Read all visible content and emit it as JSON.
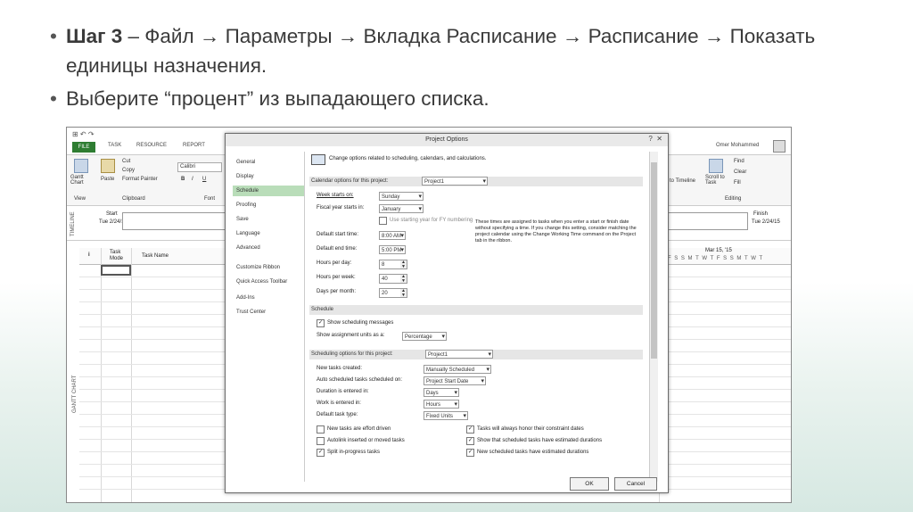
{
  "slide": {
    "bullet1_bold": "Шаг 3",
    "bullet1_text": " – Файл → Параметры → Вкладка Расписание → Расписание → Показать единицы назначения.",
    "bullet2_text": "Выберите “процент” из выпадающего списка."
  },
  "app": {
    "quick_access": "⊞ ↶ ↷",
    "tabs": [
      "FILE",
      "TASK",
      "RESOURCE",
      "REPORT"
    ],
    "user": "Omer Mohammed",
    "ribbon": {
      "gantt_chart": "Gantt Chart",
      "paste": "Paste",
      "cut": "Cut",
      "copy": "Copy",
      "format_painter": "Format Painter",
      "font": "Calibri",
      "bold": "B",
      "italic": "I",
      "underline": "U",
      "group_view": "View",
      "group_clipboard": "Clipboard",
      "group_font": "Font",
      "find": "Find",
      "clear": "Clear",
      "fill": "Fill",
      "scroll_to_task": "Scroll to Task",
      "to_timeline": "to Timeline",
      "group_editing": "Editing"
    },
    "timeline": {
      "label": "TIMELINE",
      "start_label": "Start",
      "start_date": "Tue 2/24/15",
      "finish_label": "Finish",
      "finish_date": "Tue 2/24/15"
    },
    "grid": {
      "col_info": "i",
      "col_task_mode": "Task Mode",
      "col_task_name": "Task Name",
      "gantt_label": "GANTT CHART",
      "week": "Mar 15, '15",
      "days": [
        "F",
        "S",
        "S",
        "M",
        "T",
        "W",
        "T",
        "F",
        "S",
        "S",
        "M",
        "T",
        "W",
        "T"
      ]
    }
  },
  "dialog": {
    "title": "Project Options",
    "help": "?",
    "close": "✕",
    "nav": [
      "General",
      "Display",
      "Schedule",
      "Proofing",
      "Save",
      "Language",
      "Advanced",
      "Customize Ribbon",
      "Quick Access Toolbar",
      "Add-Ins",
      "Trust Center"
    ],
    "header_text": "Change options related to scheduling, calendars, and calculations.",
    "calendar_section": "Calendar options for this project:",
    "calendar_project": "Project1",
    "week_starts_label": "Week starts on:",
    "week_starts_value": "Sunday",
    "fiscal_label": "Fiscal year starts in:",
    "fiscal_value": "January",
    "fy_numbering": "Use starting year for FY numbering",
    "start_time_label": "Default start time:",
    "start_time_value": "8:00 AM",
    "end_time_label": "Default end time:",
    "end_time_value": "5:00 PM",
    "hours_day_label": "Hours per day:",
    "hours_day_value": "8",
    "hours_week_label": "Hours per week:",
    "hours_week_value": "40",
    "days_month_label": "Days per month:",
    "days_month_value": "20",
    "note": "These times are assigned to tasks when you enter a start or finish date without specifying a time. If you change this setting, consider matching the project calendar using the Change Working Time command on the Project tab in the ribbon.",
    "schedule_section": "Schedule",
    "show_sched_msgs": "Show scheduling messages",
    "show_units_label": "Show assignment units as a:",
    "show_units_value": "Percentage",
    "sched_options_section": "Scheduling options for this project:",
    "sched_project": "Project1",
    "new_tasks_label": "New tasks created:",
    "new_tasks_value": "Manually Scheduled",
    "auto_sched_label": "Auto scheduled tasks scheduled on:",
    "auto_sched_value": "Project Start Date",
    "duration_label": "Duration is entered in:",
    "duration_value": "Days",
    "work_label": "Work is entered in:",
    "work_value": "Hours",
    "task_type_label": "Default task type:",
    "task_type_value": "Fixed Units",
    "cb_effort_driven": "New tasks are effort driven",
    "cb_autolink": "Autolink inserted or moved tasks",
    "cb_split": "Split in-progress tasks",
    "cb_honor": "Tasks will always honor their constraint dates",
    "cb_show_estimated": "Show that scheduled tasks have estimated durations",
    "cb_new_estimated": "New scheduled tasks have estimated durations",
    "ok": "OK",
    "cancel": "Cancel"
  }
}
